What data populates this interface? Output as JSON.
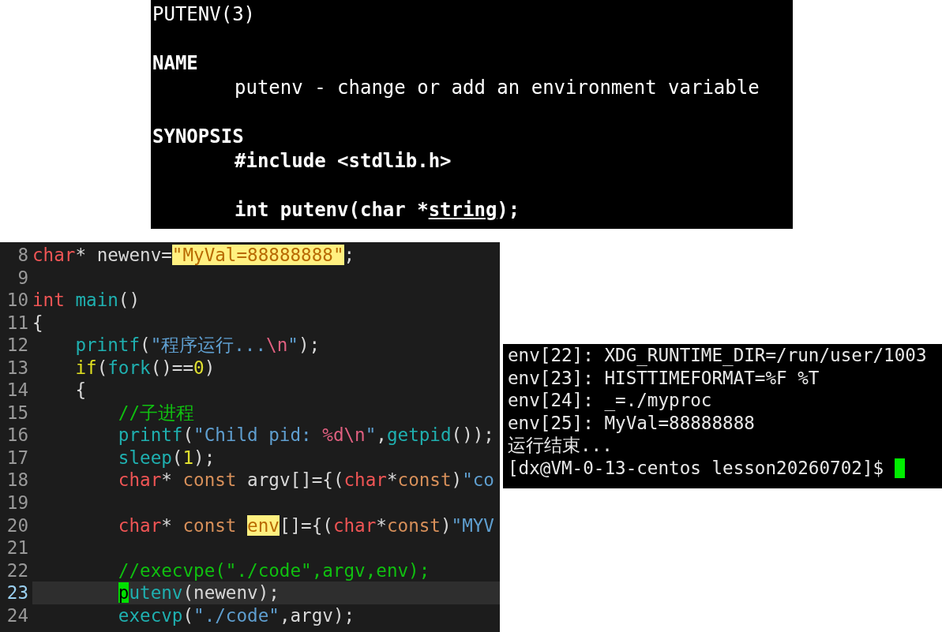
{
  "man_page": {
    "lines": [
      {
        "kind": "title",
        "text": "PUTENV(3)"
      },
      {
        "kind": "blank"
      },
      {
        "kind": "heading",
        "text": "NAME"
      },
      {
        "kind": "text",
        "text": "putenv - change or add an environment variable"
      },
      {
        "kind": "blank"
      },
      {
        "kind": "heading",
        "text": "SYNOPSIS"
      },
      {
        "kind": "code",
        "segments": [
          {
            "text": "#include <stdlib.h>",
            "kind": "keyword"
          }
        ]
      },
      {
        "kind": "blank"
      },
      {
        "kind": "code",
        "segments": [
          {
            "text": "int putenv(char *",
            "kind": "keyword"
          },
          {
            "text": "string",
            "kind": "argument"
          },
          {
            "text": ");",
            "kind": "keyword"
          }
        ]
      }
    ]
  },
  "editor": {
    "lines": [
      {
        "number": "8",
        "current": false,
        "tokens": [
          {
            "text": "char",
            "kind": "keyword"
          },
          {
            "text": "* newenv=",
            "kind": "plain"
          },
          {
            "text": "\"MyVal=88888888\"",
            "kind": "match"
          },
          {
            "text": ";",
            "kind": "plain"
          }
        ]
      },
      {
        "number": "9",
        "current": false
      },
      {
        "number": "10",
        "current": false,
        "tokens": [
          {
            "text": "int ",
            "kind": "keyword"
          },
          {
            "text": "main",
            "kind": "func"
          },
          {
            "text": "()",
            "kind": "plain"
          }
        ]
      },
      {
        "number": "11",
        "current": false,
        "tokens": [
          {
            "text": "{",
            "kind": "plain"
          }
        ]
      },
      {
        "number": "12",
        "current": false,
        "tokens": [
          {
            "text": "    printf",
            "kind": "func"
          },
          {
            "text": "(",
            "kind": "plain"
          },
          {
            "text": "\"程序运行...",
            "kind": "string"
          },
          {
            "text": "\\n",
            "kind": "escape"
          },
          {
            "text": "\"",
            "kind": "string"
          },
          {
            "text": ");",
            "kind": "plain"
          }
        ]
      },
      {
        "number": "13",
        "current": false,
        "tokens": [
          {
            "text": "    if",
            "kind": "control"
          },
          {
            "text": "(",
            "kind": "plain"
          },
          {
            "text": "fork",
            "kind": "func"
          },
          {
            "text": "()==",
            "kind": "plain"
          },
          {
            "text": "0",
            "kind": "number"
          },
          {
            "text": ")",
            "kind": "plain"
          }
        ]
      },
      {
        "number": "14",
        "current": false,
        "tokens": [
          {
            "text": "    {",
            "kind": "plain"
          }
        ]
      },
      {
        "number": "15",
        "current": false,
        "tokens": [
          {
            "text": "        //子进程",
            "kind": "comment"
          }
        ]
      },
      {
        "number": "16",
        "current": false,
        "tokens": [
          {
            "text": "        printf",
            "kind": "func"
          },
          {
            "text": "(",
            "kind": "plain"
          },
          {
            "text": "\"Child pid: ",
            "kind": "string"
          },
          {
            "text": "%d\\n",
            "kind": "escape"
          },
          {
            "text": "\"",
            "kind": "string"
          },
          {
            "text": ",",
            "kind": "plain"
          },
          {
            "text": "getpid",
            "kind": "func"
          },
          {
            "text": "());",
            "kind": "plain"
          }
        ]
      },
      {
        "number": "17",
        "current": false,
        "tokens": [
          {
            "text": "        sleep",
            "kind": "func"
          },
          {
            "text": "(",
            "kind": "plain"
          },
          {
            "text": "1",
            "kind": "number"
          },
          {
            "text": ");",
            "kind": "plain"
          }
        ]
      },
      {
        "number": "18",
        "current": false,
        "tokens": [
          {
            "text": "        char",
            "kind": "keyword"
          },
          {
            "text": "* ",
            "kind": "plain"
          },
          {
            "text": "const",
            "kind": "storage"
          },
          {
            "text": " argv[]={(",
            "kind": "plain"
          },
          {
            "text": "char",
            "kind": "keyword"
          },
          {
            "text": "*",
            "kind": "plain"
          },
          {
            "text": "const",
            "kind": "storage"
          },
          {
            "text": ")",
            "kind": "plain"
          },
          {
            "text": "\"co",
            "kind": "string"
          }
        ]
      },
      {
        "number": "19",
        "current": false
      },
      {
        "number": "20",
        "current": false,
        "tokens": [
          {
            "text": "        char",
            "kind": "keyword"
          },
          {
            "text": "* ",
            "kind": "plain"
          },
          {
            "text": "const ",
            "kind": "storage"
          },
          {
            "text": "env",
            "kind": "match"
          },
          {
            "text": "[]={(",
            "kind": "plain"
          },
          {
            "text": "char",
            "kind": "keyword"
          },
          {
            "text": "*",
            "kind": "plain"
          },
          {
            "text": "const",
            "kind": "storage"
          },
          {
            "text": ")",
            "kind": "plain"
          },
          {
            "text": "\"MYV",
            "kind": "string"
          }
        ]
      },
      {
        "number": "21",
        "current": false
      },
      {
        "number": "22",
        "current": false,
        "tokens": [
          {
            "text": "        //execvpe(\"./code\",argv,env);",
            "kind": "comment"
          }
        ]
      },
      {
        "number": "23",
        "current": true,
        "tokens": [
          {
            "text": "        p",
            "kind": "cursor"
          },
          {
            "text": "utenv",
            "kind": "func"
          },
          {
            "text": "(newenv);",
            "kind": "plain"
          }
        ]
      },
      {
        "number": "24",
        "current": false,
        "tokens": [
          {
            "text": "        execvp",
            "kind": "func"
          },
          {
            "text": "(",
            "kind": "plain"
          },
          {
            "text": "\"./code\"",
            "kind": "string"
          },
          {
            "text": ",argv);",
            "kind": "plain"
          }
        ]
      }
    ]
  },
  "terminal": {
    "lines": [
      {
        "text": "env[22]: XDG_RUNTIME_DIR=/run/user/1003",
        "cursor": false
      },
      {
        "text": "env[23]: HISTTIMEFORMAT=%F %T",
        "cursor": false
      },
      {
        "text": "env[24]: _=./myproc",
        "cursor": false
      },
      {
        "text": "env[25]: MyVal=88888888",
        "cursor": false
      },
      {
        "text": "运行结束...",
        "cursor": false
      },
      {
        "text": "[dx@VM-0-13-centos lesson20260702]$ ",
        "cursor": true
      }
    ]
  }
}
